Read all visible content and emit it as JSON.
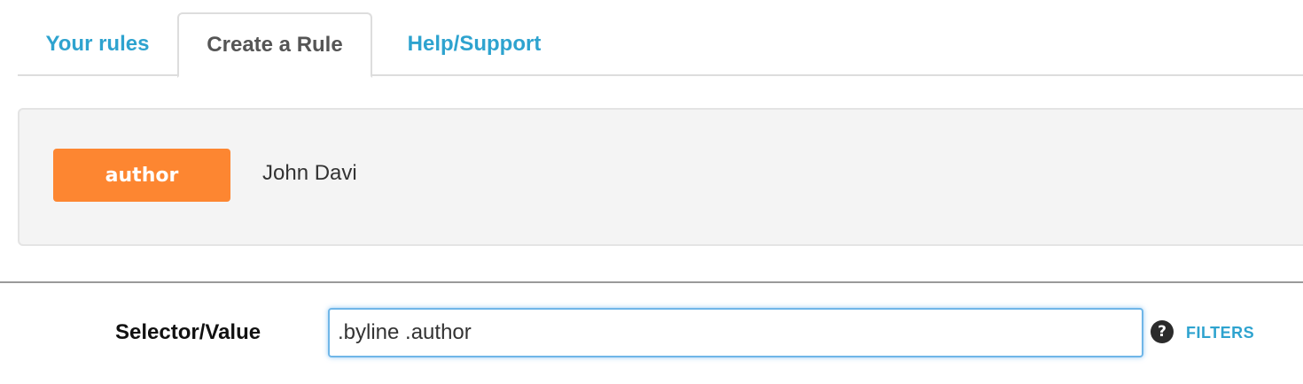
{
  "tabs": {
    "your_rules": "Your rules",
    "create_rule": "Create a Rule",
    "help_support": "Help/Support"
  },
  "preview": {
    "tag": "author",
    "value": "John Davi"
  },
  "form": {
    "label": "Selector/Value",
    "selector_value": ".byline .author",
    "help_icon": "question-circle-icon",
    "help_glyph": "?",
    "filters_label": "FILTERS"
  },
  "colors": {
    "link": "#2ea3cf",
    "badge": "#fd8631",
    "panel_bg": "#f4f4f4",
    "input_focus_border": "#6fb6e8"
  }
}
